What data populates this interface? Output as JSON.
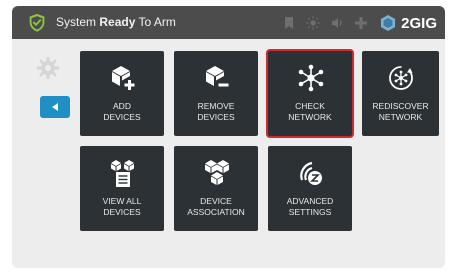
{
  "topbar": {
    "status_prefix": "System",
    "status_bold": "Ready",
    "status_suffix": "To Arm",
    "brand": "2GIG"
  },
  "menu": {
    "tiles": [
      {
        "label": "ADD\nDEVICES",
        "icon": "add-device-icon"
      },
      {
        "label": "REMOVE\nDEVICES",
        "icon": "remove-device-icon"
      },
      {
        "label": "CHECK\nNETWORK",
        "icon": "network-icon",
        "selected": true
      },
      {
        "label": "REDISCOVER\nNETWORK",
        "icon": "rediscover-icon"
      },
      {
        "label": "VIEW ALL\nDEVICES",
        "icon": "device-list-icon"
      },
      {
        "label": "DEVICE\nASSOCIATION",
        "icon": "association-icon"
      },
      {
        "label": "ADVANCED\nSETTINGS",
        "icon": "zwave-icon"
      }
    ]
  },
  "colors": {
    "topbar": "#4c4c4c",
    "tile": "#2b3134",
    "accent_blue": "#1f8fc4",
    "selected_border": "#cf2a2f",
    "shield_green": "#8fc63f"
  }
}
